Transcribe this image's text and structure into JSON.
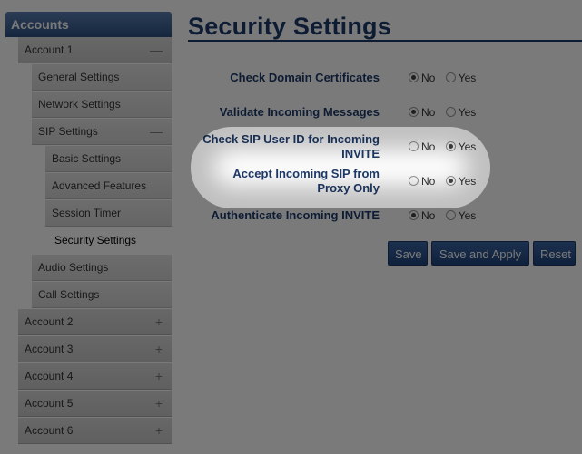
{
  "sidebar": {
    "header": "Accounts",
    "account1": {
      "label": "Account 1",
      "toggle": "—"
    },
    "items": [
      {
        "label": "General Settings"
      },
      {
        "label": "Network Settings"
      },
      {
        "label": "SIP Settings",
        "toggle": "—"
      },
      {
        "label": "Basic Settings"
      },
      {
        "label": "Advanced Features"
      },
      {
        "label": "Session Timer"
      },
      {
        "label": "Security Settings"
      },
      {
        "label": "Audio Settings"
      },
      {
        "label": "Call Settings"
      }
    ],
    "accounts": [
      {
        "label": "Account 2",
        "toggle": "+"
      },
      {
        "label": "Account 3",
        "toggle": "+"
      },
      {
        "label": "Account 4",
        "toggle": "+"
      },
      {
        "label": "Account 5",
        "toggle": "+"
      },
      {
        "label": "Account 6",
        "toggle": "+"
      }
    ]
  },
  "main": {
    "title": "Security Settings",
    "settings": [
      {
        "label": "Check Domain Certificates",
        "selected": "No"
      },
      {
        "label": "Validate Incoming Messages",
        "selected": "No"
      },
      {
        "label": "Check SIP User ID for Incoming INVITE",
        "selected": "Yes"
      },
      {
        "label": "Accept Incoming SIP from Proxy Only",
        "selected": "Yes"
      },
      {
        "label": "Authenticate Incoming INVITE",
        "selected": "No"
      }
    ],
    "option_no": "No",
    "option_yes": "Yes",
    "buttons": {
      "save": "Save",
      "save_apply": "Save and Apply",
      "reset": "Reset"
    }
  },
  "colors": {
    "accent": "#1f3b6b",
    "button": "#2d5291",
    "overlay": "rgba(0,0,0,0.52)"
  }
}
